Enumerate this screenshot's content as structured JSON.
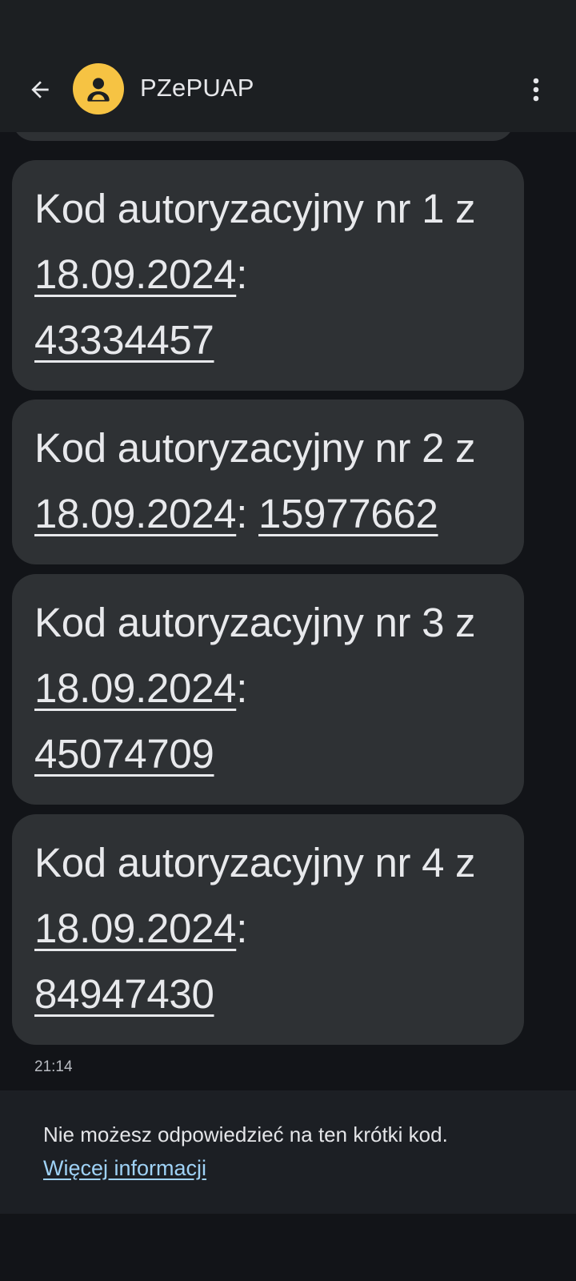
{
  "header": {
    "contact_name": "PZePUAP",
    "back_icon": "arrow-back-icon",
    "avatar_icon": "person-icon",
    "menu_icon": "more-vert-icon",
    "avatar_color": "#f6c343"
  },
  "messages": [
    {
      "prefix": "Kod autoryzacyjny nr 1 z ",
      "date": "18.09.2024",
      "separator": ":",
      "code": "43334457"
    },
    {
      "prefix": "Kod autoryzacyjny nr 2 z ",
      "date": "18.09.2024",
      "separator": ": ",
      "code": "15977662"
    },
    {
      "prefix": "Kod autoryzacyjny nr 3 z ",
      "date": "18.09.2024",
      "separator": ":",
      "code": "45074709"
    },
    {
      "prefix": "Kod autoryzacyjny nr 4 z ",
      "date": "18.09.2024",
      "separator": ":",
      "code": "84947430"
    }
  ],
  "timestamp": "21:14",
  "reply_info": {
    "text": "Nie możesz odpowiedzieć na ten krótki kod.",
    "link": "Więcej informacji",
    "link_color": "#9fd2f6"
  }
}
